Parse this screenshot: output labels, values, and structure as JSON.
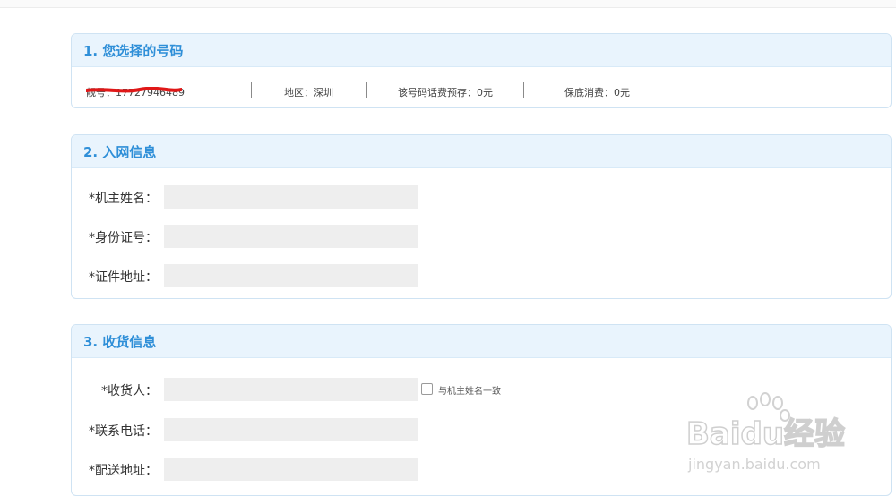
{
  "section1": {
    "title": "1. 您选择的号码",
    "number_text": "靓号：17727946489",
    "region": "地区：深圳",
    "prepay": "该号码话费预存：0元",
    "min_spend": "保底消费：0元",
    "redaction_color": "#e01818"
  },
  "section2": {
    "title": "2. 入网信息",
    "fields": [
      {
        "label": "*机主姓名：",
        "value": ""
      },
      {
        "label": "*身份证号：",
        "value": ""
      },
      {
        "label": "*证件地址：",
        "value": ""
      }
    ]
  },
  "section3": {
    "title": "3. 收货信息",
    "fields": [
      {
        "label": "*收货人：",
        "value": ""
      },
      {
        "label": "*联系电话：",
        "value": ""
      },
      {
        "label": "*配送地址：",
        "value": ""
      }
    ],
    "same_as_owner_label": "与机主姓名一致",
    "same_as_owner_checked": false
  },
  "watermark": {
    "brand": "Baidu经验",
    "url": "jingyan.baidu.com"
  },
  "colors": {
    "accent": "#2f8fd8",
    "header_bg": "#e9f4fd",
    "border": "#cfe3f3",
    "input_bg": "#eeeeee"
  }
}
